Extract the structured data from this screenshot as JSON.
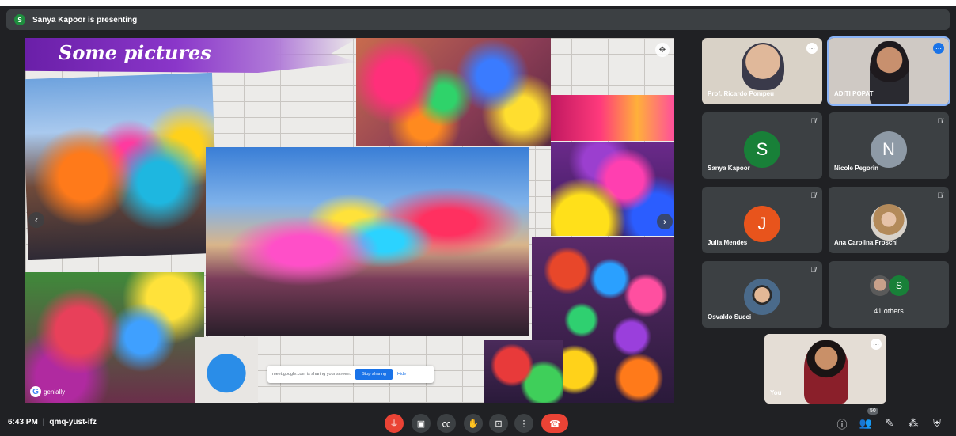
{
  "presenter_bar": {
    "text": "Sanya Kapoor is presenting",
    "avatar_initial": "S"
  },
  "slide": {
    "title": "Some pictures",
    "share_notice": "meet.google.com is sharing your screen.",
    "stop_label": "Stop sharing",
    "hide_label": "Hide",
    "brand": "genially",
    "brand_initial": "G"
  },
  "participants": [
    {
      "name": "Prof. Ricardo Pompeu",
      "type": "camera"
    },
    {
      "name": "ADITI POPAT",
      "type": "camera"
    },
    {
      "name": "Sanya Kapoor",
      "initial": "S",
      "color": "#188038"
    },
    {
      "name": "Nicole Pegorin",
      "initial": "N",
      "color": "#8e9aa6"
    },
    {
      "name": "Julia Mendes",
      "initial": "J",
      "color": "#e8541c"
    },
    {
      "name": "Ana Carolina Froschi",
      "type": "photo"
    },
    {
      "name": "Osvaldo Succi",
      "type": "photo"
    },
    {
      "name": "41 others",
      "initial": "S",
      "color": "#188038"
    }
  ],
  "self_tile": {
    "name": "You"
  },
  "bottom_bar": {
    "time": "6:43 PM",
    "meeting_code": "qmq-yust-ifz",
    "people_count": "50"
  },
  "icons": {
    "mic": "mic-off-icon",
    "camera": "camera-icon",
    "captions": "captions-icon",
    "hand": "raise-hand-icon",
    "present": "present-icon",
    "more": "more-options-icon",
    "hangup": "hang-up-icon",
    "info": "info-icon",
    "people": "people-icon",
    "chat": "chat-icon",
    "activities": "activities-icon",
    "host": "host-controls-icon"
  }
}
